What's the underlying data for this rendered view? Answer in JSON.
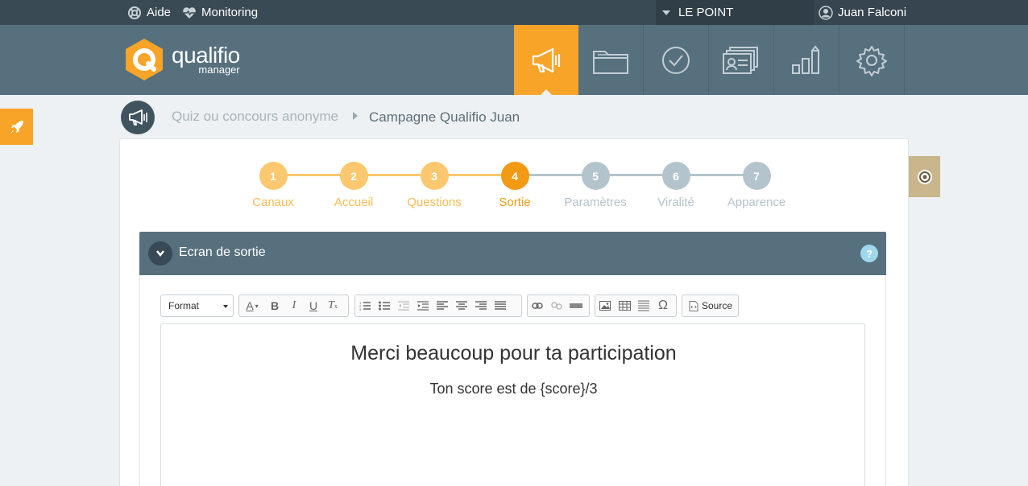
{
  "topbar": {
    "help_label": "Aide",
    "monitoring_label": "Monitoring",
    "organization": "LE POINT",
    "user_name": "Juan Falconi"
  },
  "header": {
    "logo_name": "qualifio",
    "logo_sub": "manager",
    "nav_icons": [
      "megaphone-icon",
      "folder-icon",
      "check-circle-icon",
      "contacts-icon",
      "stats-icon",
      "gear-icon"
    ],
    "active_icon": "megaphone-icon"
  },
  "breadcrumb": {
    "items": [
      "Quiz ou concours anonyme",
      "Campagne Qualifio Juan"
    ]
  },
  "steps": [
    {
      "number": "1",
      "label": "Canaux",
      "state": "done"
    },
    {
      "number": "2",
      "label": "Accueil",
      "state": "done"
    },
    {
      "number": "3",
      "label": "Questions",
      "state": "done"
    },
    {
      "number": "4",
      "label": "Sortie",
      "state": "current"
    },
    {
      "number": "5",
      "label": "Paramètres",
      "state": "todo"
    },
    {
      "number": "6",
      "label": "Viralité",
      "state": "todo"
    },
    {
      "number": "7",
      "label": "Apparence",
      "state": "todo"
    }
  ],
  "panel": {
    "title": "Ecran de sortie",
    "help": "?"
  },
  "toolbar": {
    "format_label": "Format",
    "source_label": "Source"
  },
  "editor": {
    "heading": "Merci beaucoup pour ta participation",
    "paragraph": "Ton score est de {score}/3"
  },
  "colors": {
    "accent": "#f7a428",
    "header": "#56707d",
    "topbar": "#3a4a54"
  }
}
